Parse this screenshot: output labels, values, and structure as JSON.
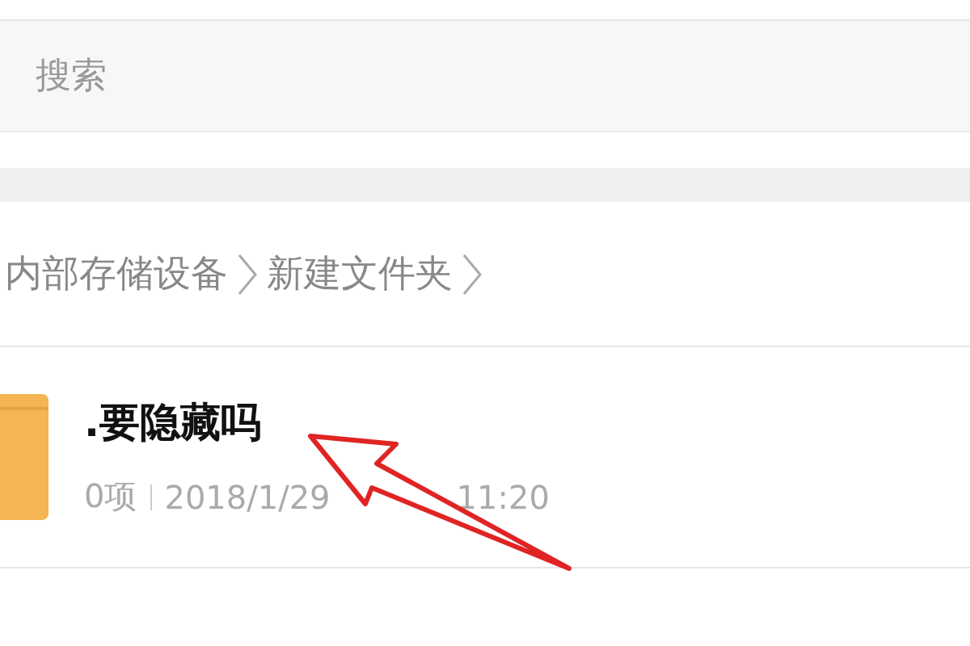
{
  "search": {
    "placeholder": "搜索"
  },
  "breadcrumb": [
    {
      "label": "内部存储设备"
    },
    {
      "label": "新建文件夹"
    }
  ],
  "files": [
    {
      "name": ".要隐藏吗",
      "count": "0项",
      "modified_date": "2018/1/29",
      "modified_time": "11:20"
    }
  ]
}
